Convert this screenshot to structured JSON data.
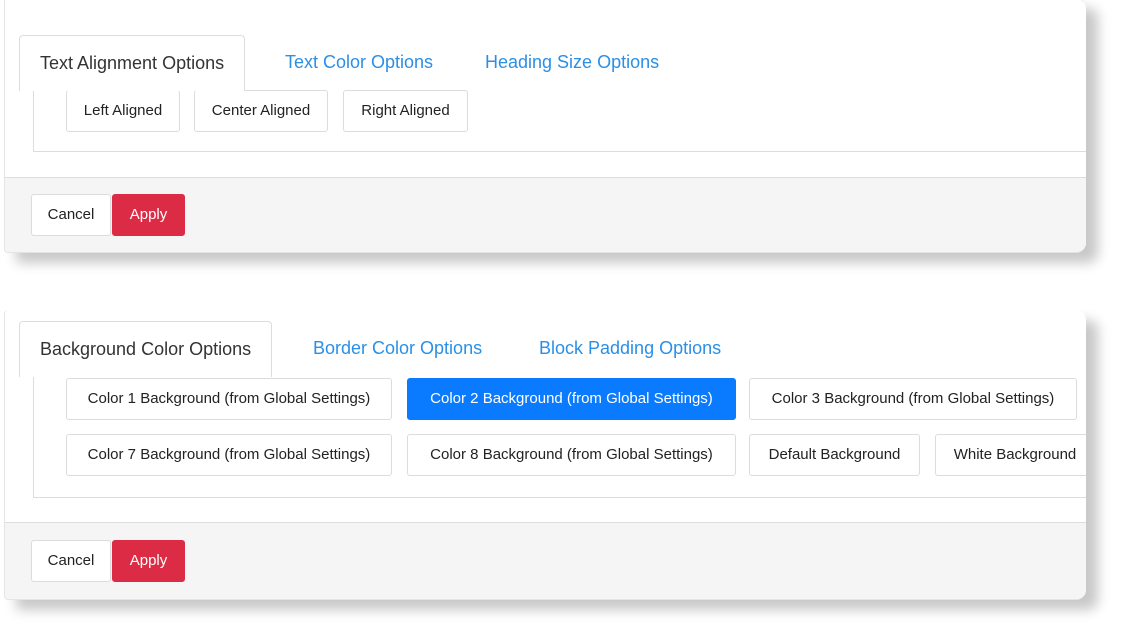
{
  "colors": {
    "tab_link": "#2b8fe6",
    "selected_option": "#0a7bff",
    "apply_button": "#dc2c45"
  },
  "panel1": {
    "tabs": [
      "Text Alignment Options",
      "Text Color Options",
      "Heading Size Options"
    ],
    "active_tab": 0,
    "options": [
      "Left Aligned",
      "Center Aligned",
      "Right Aligned"
    ],
    "cancel_label": "Cancel",
    "apply_label": "Apply"
  },
  "panel2": {
    "tabs": [
      "Background Color Options",
      "Border Color Options",
      "Block Padding Options"
    ],
    "active_tab": 0,
    "options": [
      "Color 1 Background (from Global Settings)",
      "Color 2 Background (from Global Settings)",
      "Color 3 Background (from Global Settings)",
      "Color 7 Background (from Global Settings)",
      "Color 8 Background (from Global Settings)",
      "Default Background",
      "White Background"
    ],
    "selected_option": 1,
    "cancel_label": "Cancel",
    "apply_label": "Apply"
  }
}
